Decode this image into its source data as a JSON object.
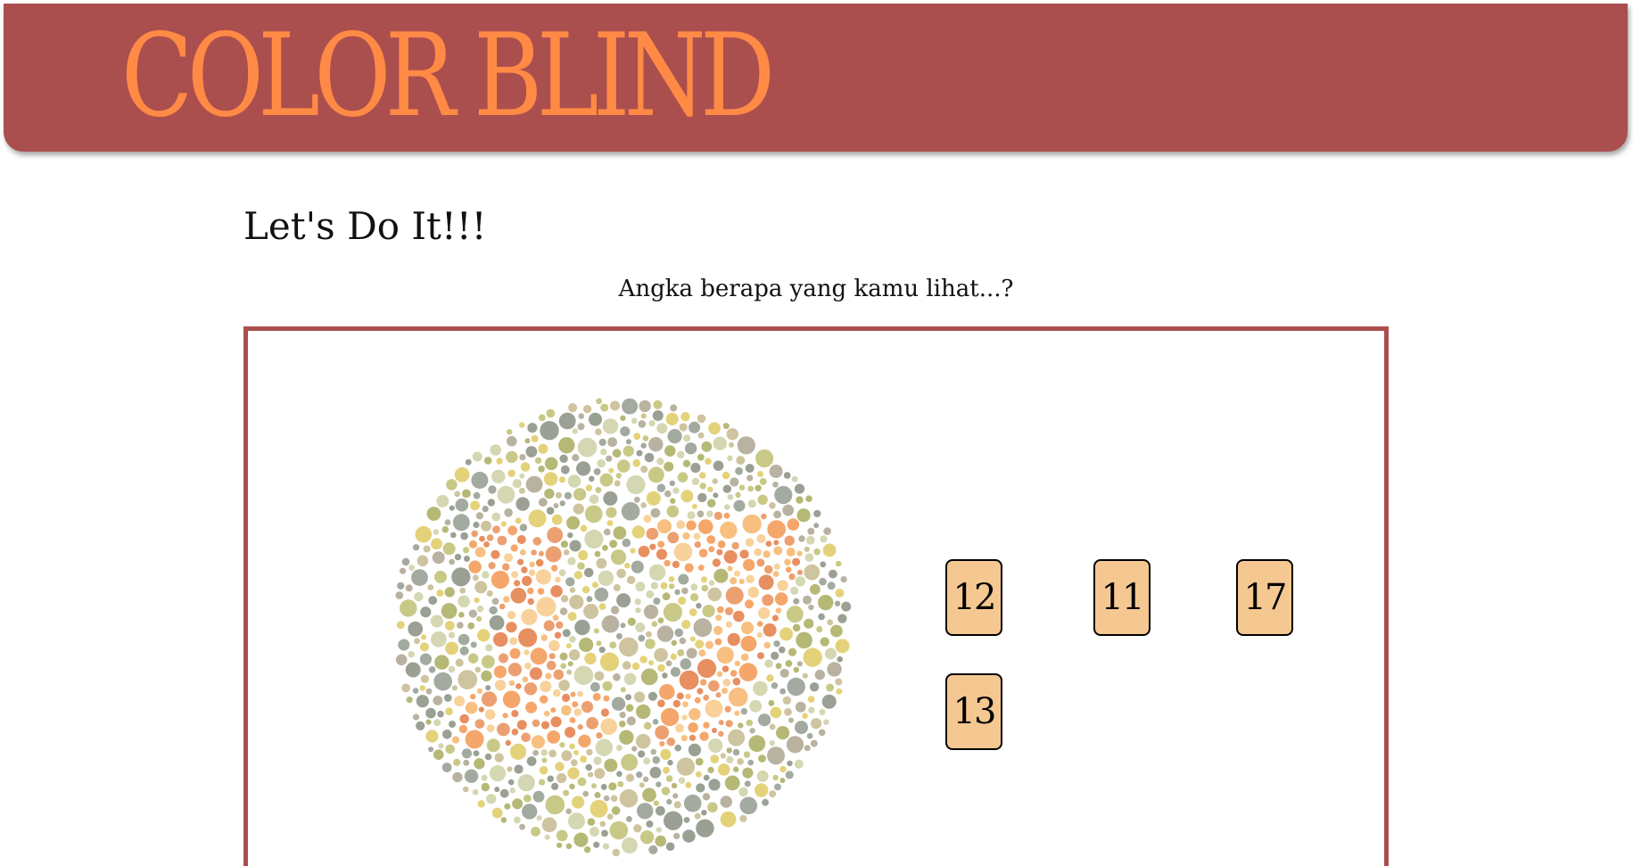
{
  "header": {
    "logo_text": "COLOR BLIND"
  },
  "main": {
    "heading": "Let's Do It!!!",
    "question": "Angka berapa yang kamu lihat...?",
    "plate": {
      "dot_colors": [
        "#a3aaa0",
        "#b6b976",
        "#d4d7b1",
        "#c9c987",
        "#e4d27a",
        "#9aa094",
        "#cfc4a0",
        "#b9b2a1"
      ],
      "figure_colors": [
        "#f5a66a",
        "#f7c081",
        "#eca071",
        "#f8d19b",
        "#e88f61"
      ]
    },
    "answers": [
      {
        "label": "12"
      },
      {
        "label": "11"
      },
      {
        "label": "17"
      },
      {
        "label": "13"
      }
    ]
  },
  "colors": {
    "header_bg": "#ab4e4e",
    "logo": "#ff8a45",
    "button_bg": "#f5c892",
    "frame_border": "#ab4e4e"
  }
}
